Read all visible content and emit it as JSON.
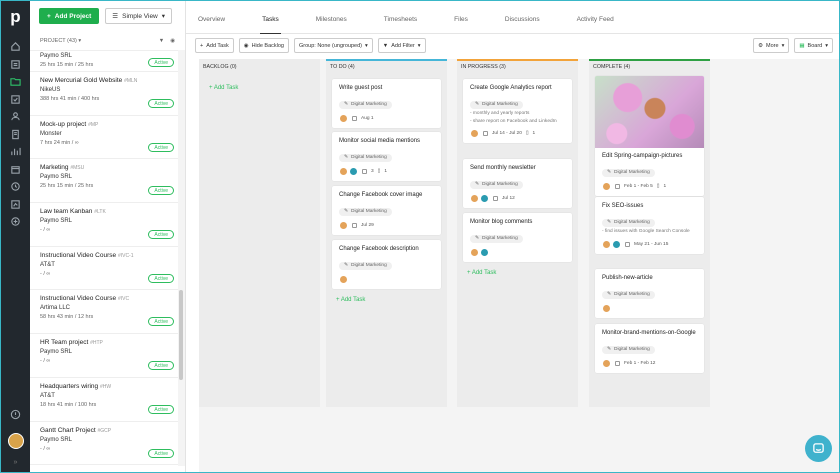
{
  "sidebar": {
    "logo": "p"
  },
  "project_panel": {
    "add_project": "Add Project",
    "view_select": "Simple View",
    "header": "PROJECT (43)",
    "projects": [
      {
        "title": "Paymo SRL",
        "code": "",
        "client": "",
        "meta": "25 hrs 15 min / 25 hrs",
        "status": "Active",
        "partial": true
      },
      {
        "title": "New Mercurial Gold Website",
        "code": "#MLN",
        "client": "NikeUS",
        "meta": "388 hrs 41 min / 400 hrs",
        "status": "Active"
      },
      {
        "title": "Mock-up project",
        "code": "#MP",
        "client": "Monster",
        "meta": "7 hrs 24 min / ∞",
        "status": "Active"
      },
      {
        "title": "Marketing",
        "code": "#MSU",
        "client": "Paymo SRL",
        "meta": "25 hrs 15 min / 25 hrs",
        "status": "Active"
      },
      {
        "title": "Law team Kanban",
        "code": "#LTK",
        "client": "Paymo SRL",
        "meta": "- / ∞",
        "status": "Active"
      },
      {
        "title": "Instructional Video Course",
        "code": "#IVC-1",
        "client": "AT&T",
        "meta": "- / ∞",
        "status": "Active"
      },
      {
        "title": "Instructional Video Course",
        "code": "#IVC",
        "client": "Artima LLC",
        "meta": "58 hrs 43 min / 12 hrs",
        "status": "Active"
      },
      {
        "title": "HR Team project",
        "code": "#HTP",
        "client": "Paymo SRL",
        "meta": "- / ∞",
        "status": "Active"
      },
      {
        "title": "Headquarters wiring",
        "code": "#HW",
        "client": "AT&T",
        "meta": "18 hrs 41 min / 100 hrs",
        "status": "Active"
      },
      {
        "title": "Gantt Chart Project",
        "code": "#GCP",
        "client": "Paymo SRL",
        "meta": "- / ∞",
        "status": "Active"
      }
    ]
  },
  "tabs": [
    "Overview",
    "Tasks",
    "Milestones",
    "Timesheets",
    "Files",
    "Discussions",
    "Activity Feed"
  ],
  "toolbar": {
    "add_task": "Add Task",
    "hide_backlog": "Hide Backlog",
    "group": "Group: None (ungrouped)",
    "add_filter": "Add Filter",
    "more": "More",
    "board": "Board"
  },
  "columns": [
    {
      "name": "BACKLOG (0)",
      "color": "#e9e9e9",
      "add": "Add Task"
    },
    {
      "name": "TO DO (4)",
      "color": "#45b6d8",
      "add": "Add Task"
    },
    {
      "name": "IN PROGRESS (3)",
      "color": "#f2a33a",
      "add": "Add Task"
    },
    {
      "name": "COMPLETE (4)",
      "color": "#2ea043",
      "add": ""
    }
  ],
  "todo_cards": [
    {
      "title": "Write guest post",
      "tag": "Digital Marketing",
      "date": "Aug 1"
    },
    {
      "title": "Monitor social media mentions",
      "tag": "Digital Marketing",
      "c1": "3",
      "c2": "1"
    },
    {
      "title": "Change Facebook cover image",
      "tag": "Digital Marketing",
      "date": "Jul 29"
    },
    {
      "title": "Change Facebook description",
      "tag": "Digital Marketing"
    }
  ],
  "inprogress_cards": [
    {
      "title": "Create Google Analytics report",
      "tag": "Digital Marketing",
      "notes": [
        "- monthly and yearly reports",
        "- share report on Facebook and LinkedIn"
      ],
      "date": "Jul 14 - Jul 20",
      "c1": "1"
    },
    {
      "title": "Send monthly newsletter",
      "tag": "Digital Marketing",
      "date": "Jul 12"
    },
    {
      "title": "Monitor blog comments",
      "tag": "Digital Marketing"
    }
  ],
  "complete_cards": [
    {
      "title": "Edit Spring-campaign-pictures",
      "tag": "Digital Marketing",
      "date": "Feb 1 - Feb 5",
      "c1": "1"
    },
    {
      "title": "Fix SEO-issues",
      "tag": "Digital Marketing",
      "notes": [
        "- find issues with Google Search Console"
      ],
      "date": "May 21 - Jun 15"
    },
    {
      "title": "Publish-new-article",
      "tag": "Digital Marketing"
    },
    {
      "title": "Monitor-brand-mentions-on-Google",
      "tag": "Digital Marketing",
      "date": "Feb 1 - Feb 12"
    }
  ]
}
